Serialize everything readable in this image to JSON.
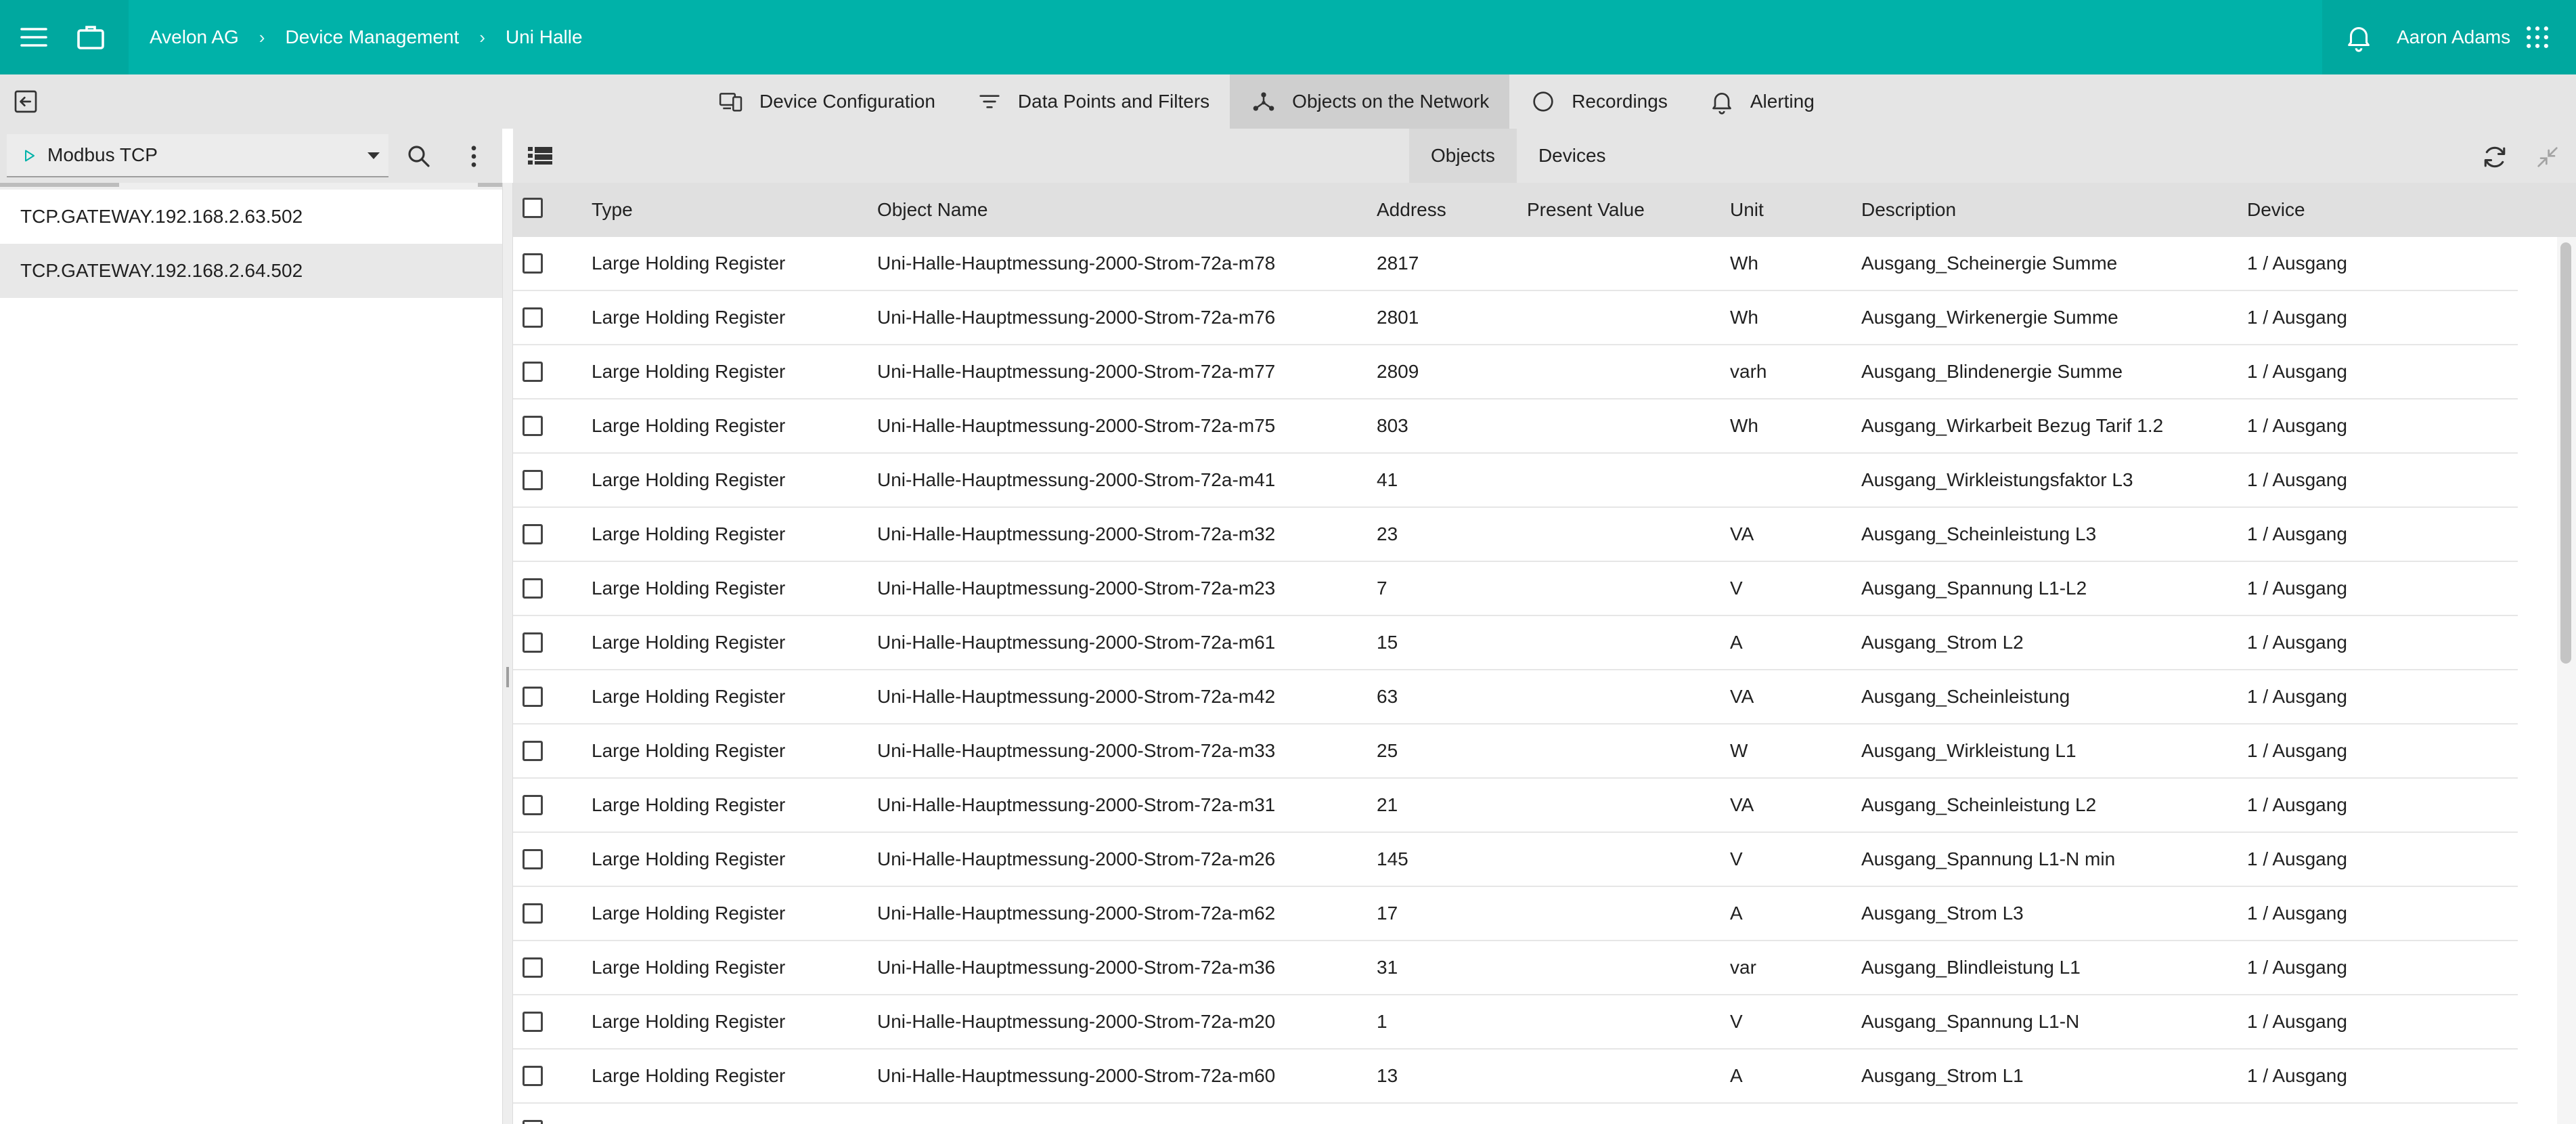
{
  "topbar": {
    "breadcrumb": [
      "Avelon AG",
      "Device Management",
      "Uni Halle"
    ],
    "breadcrumb_separator": "›",
    "user_name": "Aaron Adams",
    "color": "#00b2a9"
  },
  "tabs": [
    {
      "label": "Device Configuration",
      "icon": "device-config-icon",
      "active": false
    },
    {
      "label": "Data Points and Filters",
      "icon": "filter-icon",
      "active": false
    },
    {
      "label": "Objects on the Network",
      "icon": "network-icon",
      "active": true
    },
    {
      "label": "Recordings",
      "icon": "circle-icon",
      "active": false
    },
    {
      "label": "Alerting",
      "icon": "bell-icon",
      "active": false
    }
  ],
  "left_panel": {
    "protocol": "Modbus TCP",
    "items": [
      {
        "label": "TCP.GATEWAY.192.168.2.63.502",
        "selected": false
      },
      {
        "label": "TCP.GATEWAY.192.168.2.64.502",
        "selected": true
      }
    ]
  },
  "view_tabs": [
    {
      "label": "Objects",
      "active": true
    },
    {
      "label": "Devices",
      "active": false
    }
  ],
  "table": {
    "columns": [
      "Type",
      "Object Name",
      "Address",
      "Present Value",
      "Unit",
      "Description",
      "Device"
    ],
    "rows": [
      {
        "type": "Large Holding Register",
        "name": "Uni-Halle-Hauptmessung-2000-Strom-72a-m78",
        "address": "2817",
        "value": "",
        "unit": "Wh",
        "description": "Ausgang_Scheinergie Summe",
        "device": "1 / Ausgang"
      },
      {
        "type": "Large Holding Register",
        "name": "Uni-Halle-Hauptmessung-2000-Strom-72a-m76",
        "address": "2801",
        "value": "",
        "unit": "Wh",
        "description": "Ausgang_Wirkenergie Summe",
        "device": "1 / Ausgang"
      },
      {
        "type": "Large Holding Register",
        "name": "Uni-Halle-Hauptmessung-2000-Strom-72a-m77",
        "address": "2809",
        "value": "",
        "unit": "varh",
        "description": "Ausgang_Blindenergie Summe",
        "device": "1 / Ausgang"
      },
      {
        "type": "Large Holding Register",
        "name": "Uni-Halle-Hauptmessung-2000-Strom-72a-m75",
        "address": "803",
        "value": "",
        "unit": "Wh",
        "description": "Ausgang_Wirkarbeit Bezug Tarif 1.2",
        "device": "1 / Ausgang"
      },
      {
        "type": "Large Holding Register",
        "name": "Uni-Halle-Hauptmessung-2000-Strom-72a-m41",
        "address": "41",
        "value": "",
        "unit": "",
        "description": "Ausgang_Wirkleistungsfaktor L3",
        "device": "1 / Ausgang"
      },
      {
        "type": "Large Holding Register",
        "name": "Uni-Halle-Hauptmessung-2000-Strom-72a-m32",
        "address": "23",
        "value": "",
        "unit": "VA",
        "description": "Ausgang_Scheinleistung L3",
        "device": "1 / Ausgang"
      },
      {
        "type": "Large Holding Register",
        "name": "Uni-Halle-Hauptmessung-2000-Strom-72a-m23",
        "address": "7",
        "value": "",
        "unit": "V",
        "description": "Ausgang_Spannung L1-L2",
        "device": "1 / Ausgang"
      },
      {
        "type": "Large Holding Register",
        "name": "Uni-Halle-Hauptmessung-2000-Strom-72a-m61",
        "address": "15",
        "value": "",
        "unit": "A",
        "description": "Ausgang_Strom L2",
        "device": "1 / Ausgang"
      },
      {
        "type": "Large Holding Register",
        "name": "Uni-Halle-Hauptmessung-2000-Strom-72a-m42",
        "address": "63",
        "value": "",
        "unit": "VA",
        "description": "Ausgang_Scheinleistung",
        "device": "1 / Ausgang"
      },
      {
        "type": "Large Holding Register",
        "name": "Uni-Halle-Hauptmessung-2000-Strom-72a-m33",
        "address": "25",
        "value": "",
        "unit": "W",
        "description": "Ausgang_Wirkleistung L1",
        "device": "1 / Ausgang"
      },
      {
        "type": "Large Holding Register",
        "name": "Uni-Halle-Hauptmessung-2000-Strom-72a-m31",
        "address": "21",
        "value": "",
        "unit": "VA",
        "description": "Ausgang_Scheinleistung L2",
        "device": "1 / Ausgang"
      },
      {
        "type": "Large Holding Register",
        "name": "Uni-Halle-Hauptmessung-2000-Strom-72a-m26",
        "address": "145",
        "value": "",
        "unit": "V",
        "description": "Ausgang_Spannung L1-N min",
        "device": "1 / Ausgang"
      },
      {
        "type": "Large Holding Register",
        "name": "Uni-Halle-Hauptmessung-2000-Strom-72a-m62",
        "address": "17",
        "value": "",
        "unit": "A",
        "description": "Ausgang_Strom L3",
        "device": "1 / Ausgang"
      },
      {
        "type": "Large Holding Register",
        "name": "Uni-Halle-Hauptmessung-2000-Strom-72a-m36",
        "address": "31",
        "value": "",
        "unit": "var",
        "description": "Ausgang_Blindleistung L1",
        "device": "1 / Ausgang"
      },
      {
        "type": "Large Holding Register",
        "name": "Uni-Halle-Hauptmessung-2000-Strom-72a-m20",
        "address": "1",
        "value": "",
        "unit": "V",
        "description": "Ausgang_Spannung L1-N",
        "device": "1 / Ausgang"
      },
      {
        "type": "Large Holding Register",
        "name": "Uni-Halle-Hauptmessung-2000-Strom-72a-m60",
        "address": "13",
        "value": "",
        "unit": "A",
        "description": "Ausgang_Strom L1",
        "device": "1 / Ausgang"
      }
    ]
  }
}
